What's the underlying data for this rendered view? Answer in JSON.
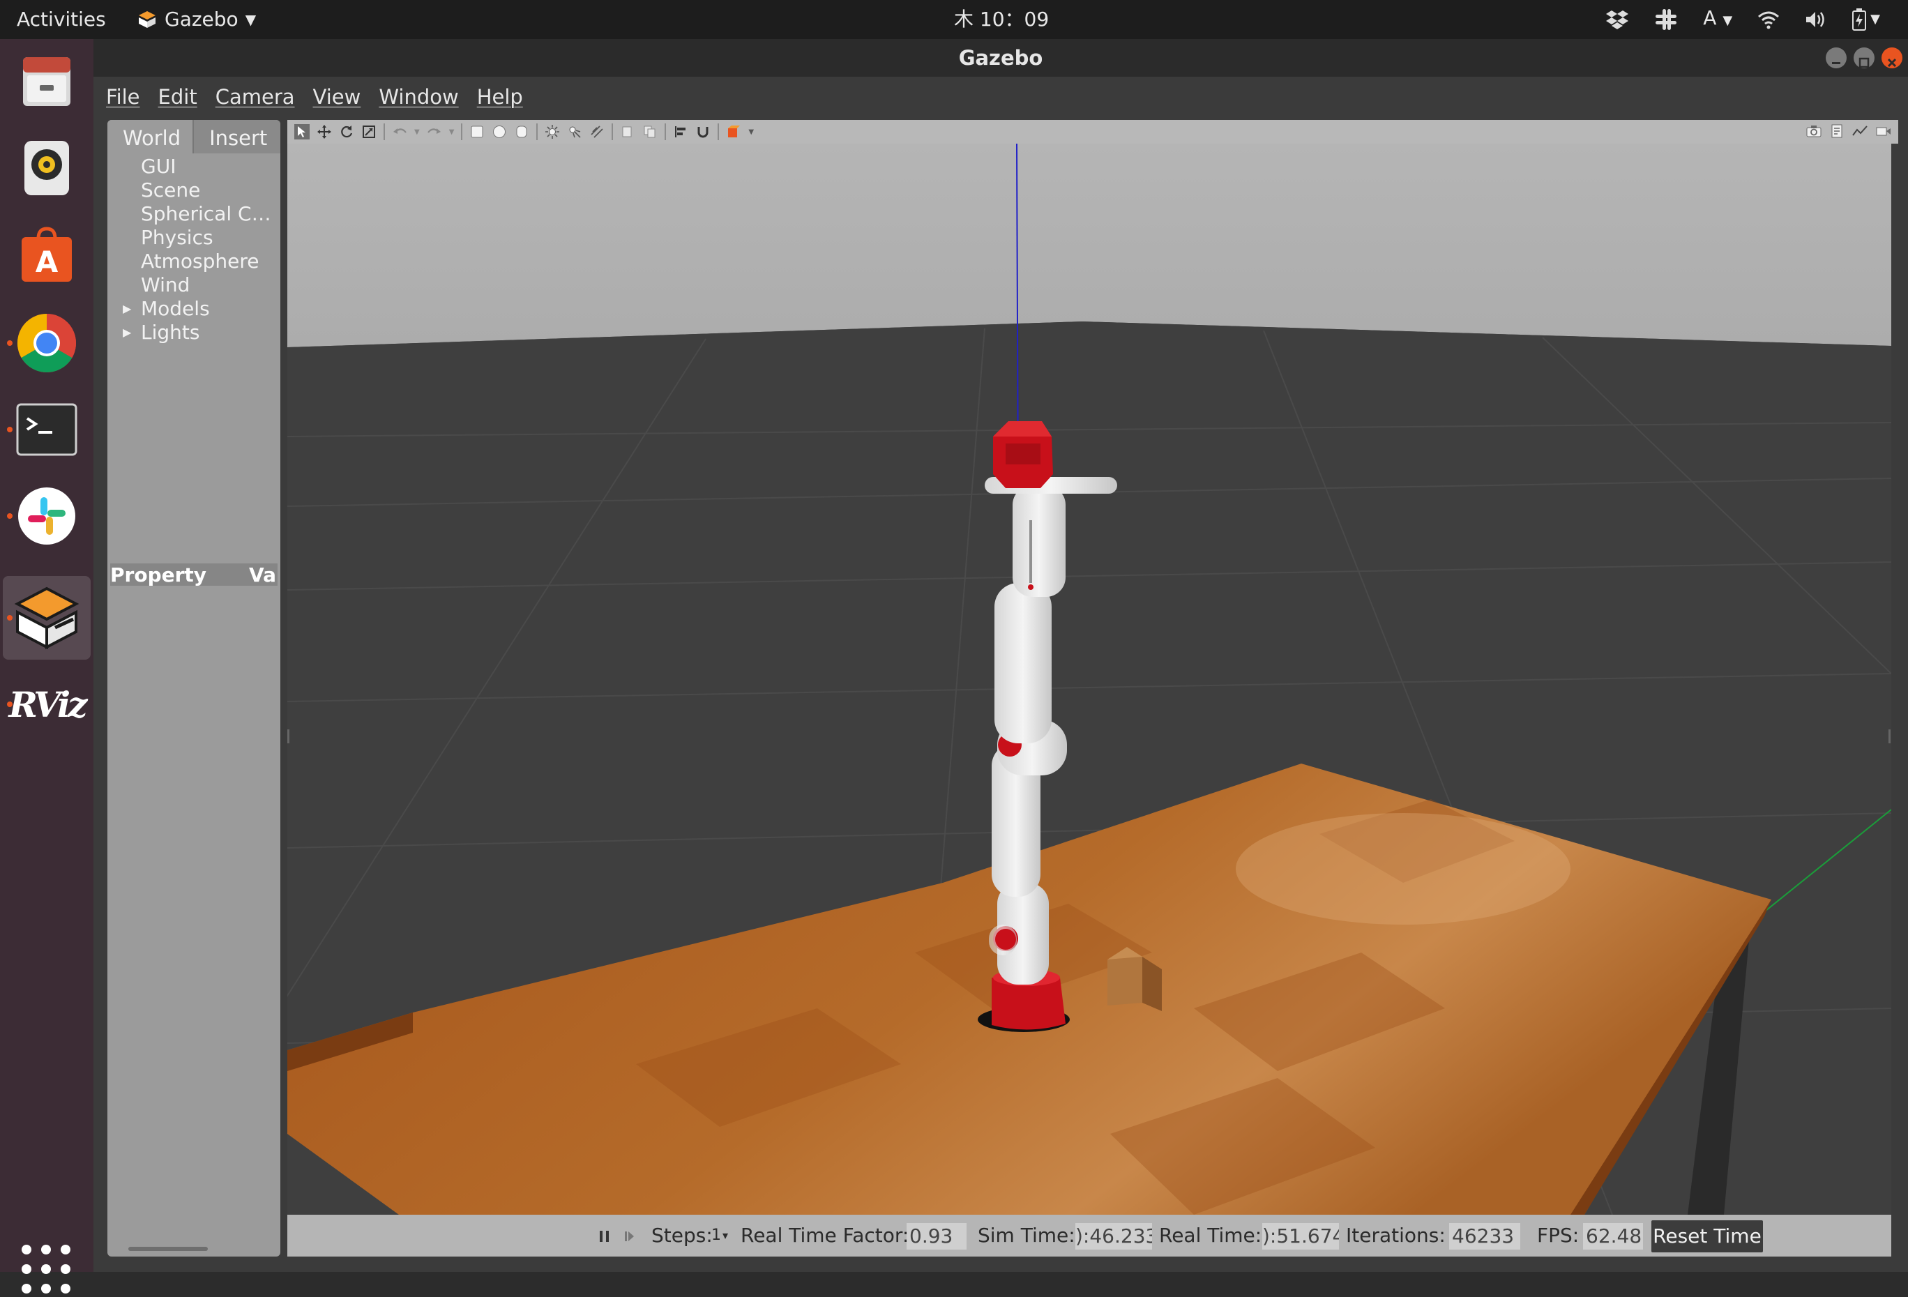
{
  "topbar": {
    "activities": "Activities",
    "app_name": "Gazebo",
    "clock": "木 10：09",
    "input_method": "A"
  },
  "dock": {
    "items": [
      {
        "name": "files",
        "icon": "file-cabinet-icon"
      },
      {
        "name": "rhythmbox",
        "icon": "speaker-icon"
      },
      {
        "name": "ubuntu-software",
        "icon": "software-bag-icon"
      },
      {
        "name": "chrome",
        "icon": "chrome-icon"
      },
      {
        "name": "terminal",
        "icon": "terminal-icon"
      },
      {
        "name": "slack",
        "icon": "slack-icon"
      },
      {
        "name": "gazebo",
        "icon": "gazebo-icon"
      },
      {
        "name": "rviz",
        "icon": "rviz-icon",
        "label": "RViz"
      }
    ]
  },
  "window": {
    "title": "Gazebo",
    "menu": [
      "File",
      "Edit",
      "Camera",
      "View",
      "Window",
      "Help"
    ]
  },
  "left_panel": {
    "tabs": [
      "World",
      "Insert"
    ],
    "tree": [
      "GUI",
      "Scene",
      "Spherical Co...",
      "Physics",
      "Atmosphere",
      "Wind",
      "Models",
      "Lights"
    ],
    "property_header": {
      "property": "Property",
      "value": "Va"
    }
  },
  "statusbar": {
    "steps_label": "Steps:",
    "steps_value": "1",
    "rtf_label": "Real Time Factor:",
    "rtf_value": "0.93",
    "sim_time_label": "Sim Time:",
    "sim_time_value": "):46.233",
    "real_time_label": "Real Time:",
    "real_time_value": "):51.674",
    "iterations_label": "Iterations:",
    "iterations_value": "46233",
    "fps_label": "FPS:",
    "fps_value": "62.48",
    "reset_button": "Reset Time"
  },
  "colors": {
    "ubuntu_orange": "#e95420",
    "dock_bg": "#3c2c35",
    "robot_red": "#c8101a",
    "table_wood": "#b36a28"
  }
}
